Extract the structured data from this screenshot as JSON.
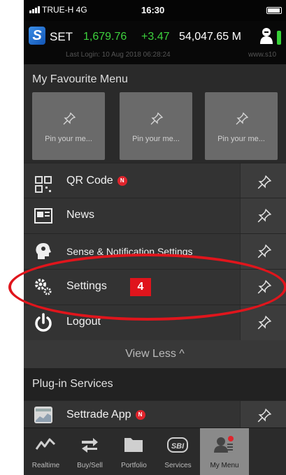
{
  "status_bar": {
    "carrier": "TRUE-H  4G",
    "time": "16:30"
  },
  "ticker": {
    "logo": "S",
    "index_name": "SET",
    "index_value": "1,679.76",
    "change": "+3.47",
    "volume": "54,047.65 M",
    "last_login": "Last Login: 10 Aug 2018 06:28:24",
    "website": "www.s10",
    "up_color": "#3dd13d"
  },
  "favourite_menu": {
    "title": "My Favourite Menu",
    "cards": [
      "Pin your me...",
      "Pin your me...",
      "Pin your me..."
    ]
  },
  "menu_items": [
    {
      "label": "QR Code",
      "icon": "qr-code-icon",
      "badge": "N"
    },
    {
      "label": "News",
      "icon": "news-icon"
    },
    {
      "label": "Sense & Notification Settings",
      "icon": "sense-head-icon"
    },
    {
      "label": "Settings",
      "icon": "gears-icon",
      "step": "4"
    },
    {
      "label": "Logout",
      "icon": "power-icon"
    }
  ],
  "view_less": "View Less ^",
  "plugin_services": {
    "title": "Plug-in Services",
    "items": [
      {
        "label": "Settrade App",
        "badge": "N",
        "icon": "settrade-app-icon"
      }
    ]
  },
  "tab_bar": {
    "tabs": [
      {
        "label": "Realtime",
        "icon": "realtime-chart-icon"
      },
      {
        "label": "Buy/Sell",
        "icon": "buy-sell-arrows-icon"
      },
      {
        "label": "Portfolio",
        "icon": "folder-icon"
      },
      {
        "label": "Services",
        "icon": "sbi-icon",
        "icon_text": "SBI"
      },
      {
        "label": "My Menu",
        "icon": "my-menu-person-icon",
        "active": true
      }
    ]
  },
  "highlight_color": "#e0151c"
}
